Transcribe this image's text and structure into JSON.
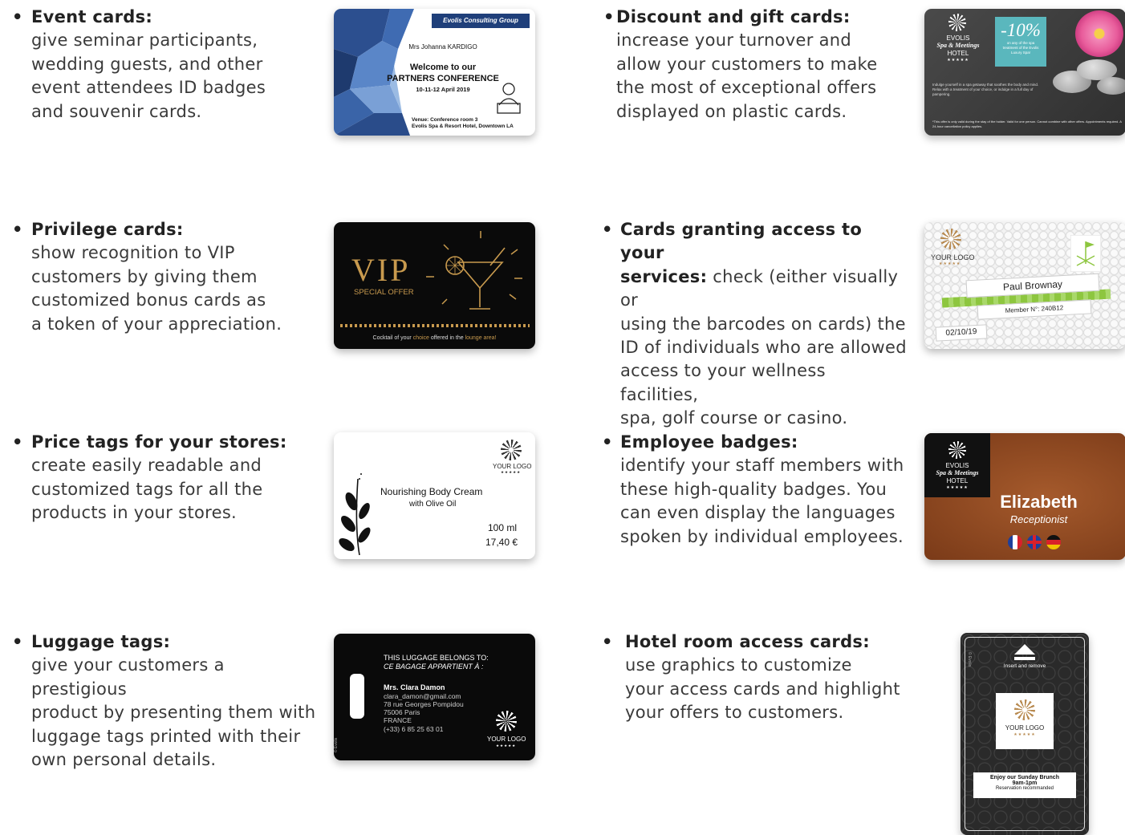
{
  "items": [
    {
      "bullet": "•",
      "head": "Event cards:",
      "body": [
        "give seminar participants,",
        "wedding guests, and other",
        "event attendees ID badges",
        "and souvenir cards."
      ]
    },
    {
      "bullet": "•",
      "head": "Discount and gift cards:",
      "body": [
        "increase your turnover and",
        "allow your customers to make",
        "the most of exceptional offers",
        "displayed on plastic cards."
      ]
    },
    {
      "bullet": "•",
      "head": "Privilege cards:",
      "body": [
        "show recognition to VIP",
        "customers by giving them",
        "customized bonus cards as",
        "a token of your appreciation."
      ]
    },
    {
      "bullet": "•",
      "head": "Cards granting access to your",
      "head2": "services:",
      "body_first": " check (either visually or",
      "body": [
        "using the barcodes on cards) the",
        "ID of individuals who are allowed",
        "access to your wellness facilities,",
        "spa, golf course or casino."
      ]
    },
    {
      "bullet": "•",
      "head": "Price tags for your stores:",
      "body": [
        "create easily readable and",
        "customized tags for all the",
        "products in your stores."
      ]
    },
    {
      "bullet": "•",
      "head": "Employee badges:",
      "body": [
        "identify your staff members with",
        "these high-quality badges. You",
        "can even display the languages",
        "spoken by individual employees."
      ]
    },
    {
      "bullet": "•",
      "head": "Luggage tags:",
      "body": [
        "give your customers a prestigious",
        "product by presenting them with",
        "luggage tags printed with their",
        "own personal details."
      ]
    },
    {
      "bullet": "•",
      "head": "Hotel room access cards:",
      "body": [
        "use graphics to customize",
        "your access cards and highlight",
        "your offers to customers."
      ]
    }
  ],
  "cards": {
    "event": {
      "company": "Evolis Consulting Group",
      "name": "Mrs Johanna KARDIGO",
      "welcome": "Welcome to our",
      "conference": "PARTNERS CONFERENCE",
      "dates": "10-11-12 April 2019",
      "venue1": "Venue: Conference room 3",
      "venue2": "Evolis Spa & Resort Hotel, Downtown LA"
    },
    "gift": {
      "brand1": "EVOLIS",
      "brand2": "Spa & Meetings",
      "brand3": "HOTEL",
      "stars": "★★★★★",
      "discount": "-10%",
      "offer": "on any of the spa treatment of the Evolis Luxury Spa!",
      "text": "Indulge yourself in a spa getaway that soothes the body and mind. Relax with a treatment of your choice, or indulge in a full day of pampering.",
      "fine": "*This offer is only valid during the stay of the holder. Valid for one person. Cannot combine with other offers. Appointments required. A 24-hour cancellation policy applies."
    },
    "vip": {
      "title": "VIP",
      "sub": "SPECIAL OFFER",
      "bottom_a": "Cocktail of your ",
      "bottom_b": "choice",
      "bottom_c": " offered in the ",
      "bottom_d": "lounge area!"
    },
    "golf": {
      "logo": "YOUR LOGO",
      "stars": "★★★★★",
      "name": "Paul Brownay",
      "member": "Member N°: 240B12",
      "date": "02/10/19"
    },
    "price": {
      "logo": "YOUR LOGO",
      "stars": "★★★★★",
      "product": "Nourishing Body Cream",
      "sub": "with Olive Oil",
      "qty": "100 ml",
      "price": "17,40 €"
    },
    "badge": {
      "brand1": "EVOLIS",
      "brand2": "Spa & Meetings",
      "brand3": "HOTEL",
      "stars": "★★★★★",
      "name": "Elizabeth",
      "role": "Receptionist"
    },
    "luggage": {
      "line1": "THIS LUGGAGE BELONGS TO:",
      "line2": "CE BAGAGE APPARTIENT À :",
      "name": "Mrs. Clara Damon",
      "email": "clara_damon@gmail.com",
      "addr1": "78 rue Georges Pompidou",
      "addr2": "75006  Paris",
      "country": "FRANCE",
      "phone": "(+33) 6 85 25 63 01",
      "logo": "YOUR LOGO",
      "stars": "★★★★★",
      "copyright": "© Evolis"
    },
    "hotel": {
      "insert": "Insert and remove",
      "logo": "YOUR LOGO",
      "stars": "★★★★★",
      "offer1": "Enjoy our Sunday Brunch",
      "offer2": "9am-1pm",
      "offer3": "Reservation recommanded",
      "copyright": "© Evolis"
    }
  },
  "colors": {
    "text": "#3a3a3a",
    "heading": "#222222",
    "event_blue": "#1f3f7a",
    "vip_gold": "#c89a4e",
    "gift_teal": "#5ab7bd",
    "golf_green": "#8dc63f",
    "badge_brown": "#8a4a24"
  }
}
